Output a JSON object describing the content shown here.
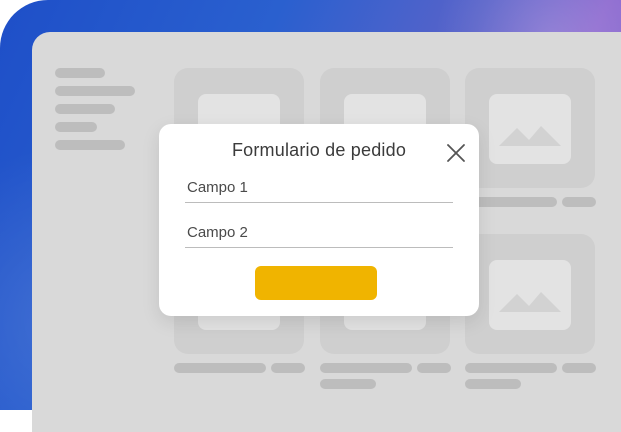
{
  "modal": {
    "title": "Formulario de pedido",
    "close_icon": "close-icon",
    "fields": [
      {
        "placeholder": "Campo 1"
      },
      {
        "placeholder": "Campo 2"
      }
    ],
    "submit_label": "",
    "accent_color": "#f0b400"
  },
  "background": {
    "gradient_colors": [
      "#1e4fc8",
      "#8c68cf"
    ],
    "window_color": "#d9d9d9"
  },
  "gallery": {
    "image_placeholder_icon": "image-icon"
  }
}
